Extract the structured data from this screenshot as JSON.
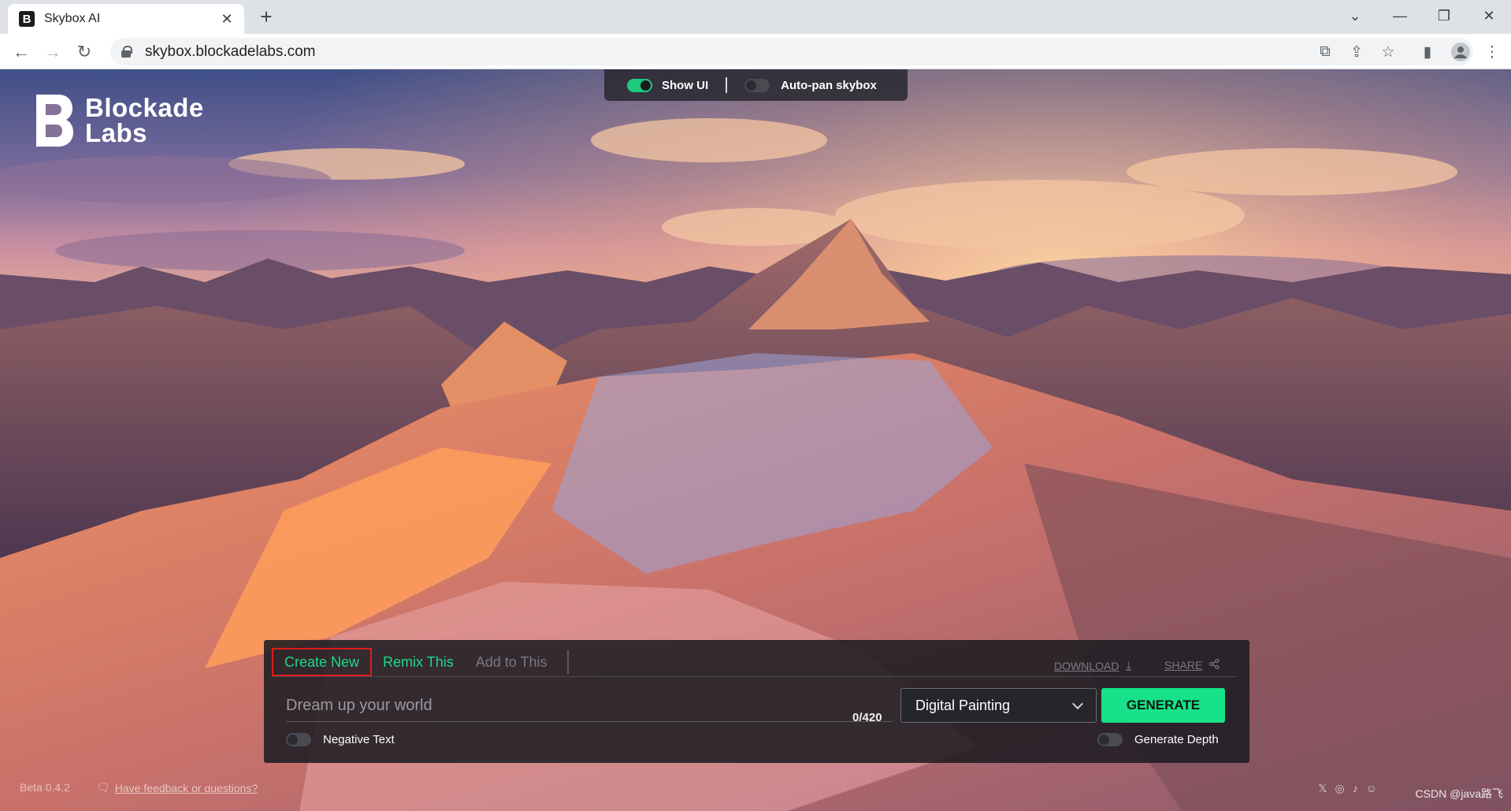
{
  "browser": {
    "tab_title": "Skybox AI",
    "favicon_letter": "B",
    "url": "skybox.blockadelabs.com"
  },
  "topbar": {
    "show_ui_label": "Show UI",
    "show_ui_on": true,
    "autopan_label": "Auto-pan skybox",
    "autopan_on": false
  },
  "logo": {
    "line1": "Blockade",
    "line2": "Labs"
  },
  "panel": {
    "tabs": [
      {
        "label": "Create New",
        "state": "active"
      },
      {
        "label": "Remix This",
        "state": "enabled"
      },
      {
        "label": "Add to This",
        "state": "disabled"
      }
    ],
    "download_label": "DOWNLOAD",
    "share_label": "SHARE",
    "prompt_placeholder": "Dream up your world",
    "prompt_value": "",
    "counter": "0/420",
    "style_value": "Digital Painting",
    "generate_label": "GENERATE",
    "negative_text_label": "Negative Text",
    "generate_depth_label": "Generate Depth"
  },
  "footer": {
    "version": "Beta 0.4.2",
    "feedback": "Have feedback or questions?",
    "watermark": "CSDN @java路飞"
  },
  "colors": {
    "accent": "#17e189",
    "highlight_box": "#e11b1b"
  }
}
